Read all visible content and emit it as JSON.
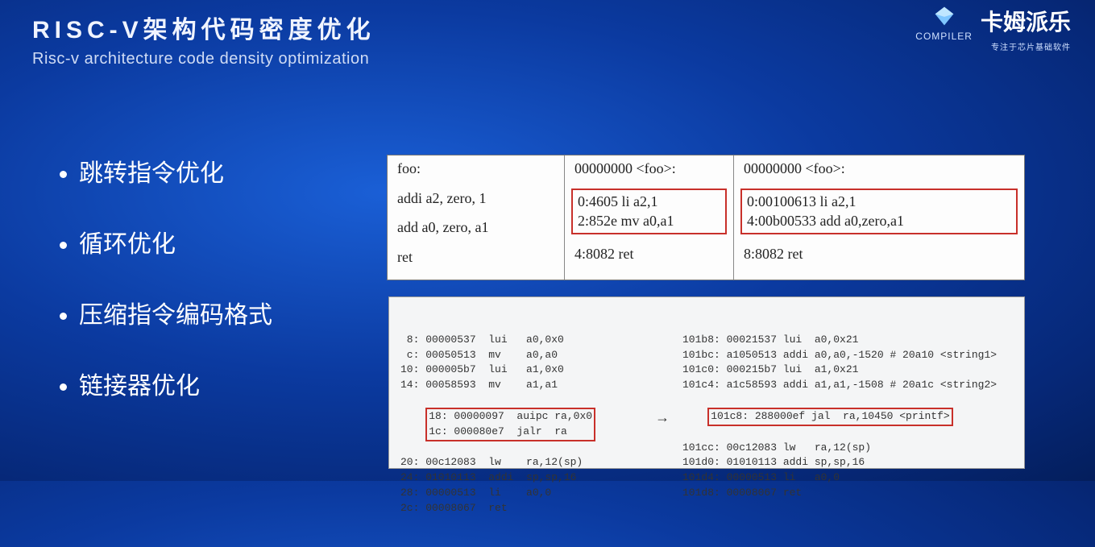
{
  "header": {
    "title_cn": "RISC-V架构代码密度优化",
    "title_en": "Risc-v architecture code density optimization"
  },
  "logo": {
    "compiler": "COMPILER",
    "name_cn": "卡姆派乐",
    "subtitle": "专注于芯片基础软件"
  },
  "bullets": [
    "跳转指令优化",
    "循环优化",
    "压缩指令编码格式",
    "链接器优化"
  ],
  "top_panel": {
    "col1": {
      "hdr": "foo:",
      "rows": [
        "addi a2, zero, 1",
        "add a0, zero, a1",
        "ret"
      ]
    },
    "col2": {
      "hdr": "00000000 <foo>:",
      "boxed": [
        "0:4605   li    a2,1",
        "2:852e   mv  a0,a1"
      ],
      "tail": "4:8082   ret"
    },
    "col3": {
      "hdr": "00000000 <foo>:",
      "boxed": [
        "0:00100613  li    a2,1",
        "4:00b00533  add  a0,zero,a1"
      ],
      "tail": "8:8082        ret"
    }
  },
  "bottom_panel": {
    "left_pre": " 8: 00000537  lui   a0,0x0\n c: 00050513  mv    a0,a0\n10: 000005b7  lui   a1,0x0\n14: 00058593  mv    a1,a1",
    "left_box": "18: 00000097  auipc ra,0x0\n1c: 000080e7  jalr  ra",
    "left_post": "20: 00c12083  lw    ra,12(sp)\n24: 01010113  addi  sp,sp,16\n28: 00000513  li    a0,0\n2c: 00008067  ret",
    "arrow": "→",
    "right_pre": "101b8: 00021537 lui  a0,0x21\n101bc: a1050513 addi a0,a0,-1520 # 20a10 <string1>\n101c0: 000215b7 lui  a1,0x21\n101c4: a1c58593 addi a1,a1,-1508 # 20a1c <string2>",
    "right_box": "101c8: 288000ef jal  ra,10450 <printf>",
    "right_post": "101cc: 00c12083 lw   ra,12(sp)\n101d0: 01010113 addi sp,sp,16\n101d4: 00000513 li   a0,0\n101d8: 00008067 ret"
  }
}
